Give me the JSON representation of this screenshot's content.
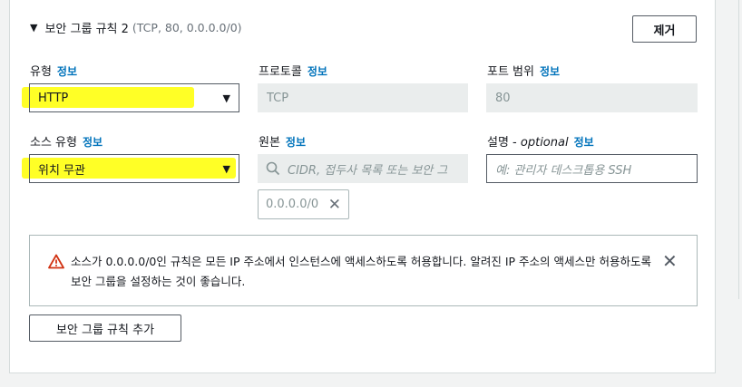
{
  "rule": {
    "title": "보안 그룹 규칙 2",
    "meta": "(TCP, 80, 0.0.0.0/0)",
    "remove_label": "제거"
  },
  "fields": {
    "type": {
      "label": "유형",
      "info": "정보",
      "value": "HTTP"
    },
    "protocol": {
      "label": "프로토콜",
      "info": "정보",
      "value": "TCP"
    },
    "port_range": {
      "label": "포트 범위",
      "info": "정보",
      "value": "80"
    },
    "source_type": {
      "label": "소스 유형",
      "info": "정보",
      "value": "위치 무관"
    },
    "source": {
      "label": "원본",
      "info": "정보",
      "placeholder": "CIDR, 접두사 목록 또는 보안 그",
      "token": "0.0.0.0/0"
    },
    "description": {
      "label": "설명",
      "optional": "optional",
      "info": "정보",
      "placeholder": "예: 관리자 데스크톱용 SSH"
    }
  },
  "alert": {
    "message": "소스가 0.0.0.0/0인 규칙은 모든 IP 주소에서 인스턴스에 액세스하도록 허용합니다. 알려진 IP 주소의 액세스만 허용하도록 보안 그룹을 설정하는 것이 좋습니다."
  },
  "add_rule_label": "보안 그룹 규칙 추가",
  "colors": {
    "info_link": "#0073bb",
    "warning": "#d13212",
    "highlight": "#ffff00"
  },
  "icons": [
    "caret-down-icon",
    "dropdown-arrow-icon",
    "search-icon",
    "remove-token-icon",
    "warning-icon",
    "close-icon"
  ]
}
